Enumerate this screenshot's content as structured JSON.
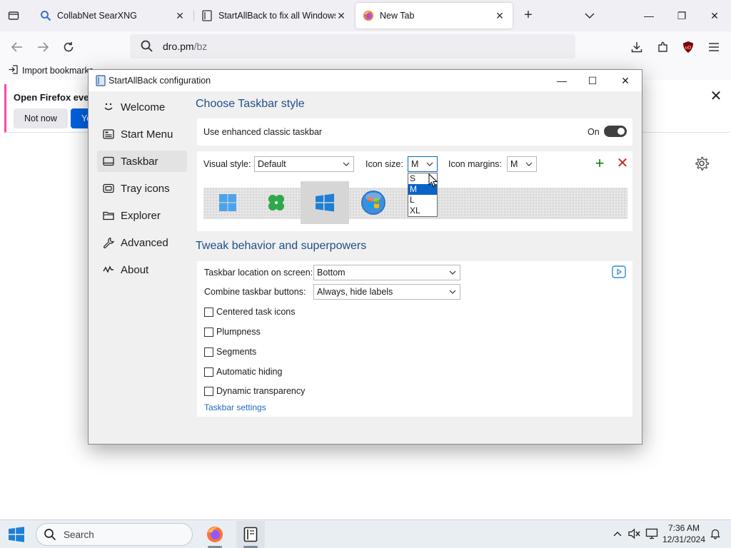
{
  "browser": {
    "tabs": [
      {
        "title": "CollabNet SearXNG",
        "active": false
      },
      {
        "title": "StartAllBack to fix all Windows",
        "active": false
      },
      {
        "title": "New Tab",
        "active": true
      }
    ],
    "new_tab_label": "+",
    "window_controls": {
      "minimize": "—",
      "restore": "❐",
      "close": "✕"
    },
    "url_host": "dro.pm",
    "url_path": "/bz",
    "bookmark_item": "Import bookmarks…",
    "notification": {
      "text": "Open Firefox every",
      "secondary_button": "Not now",
      "primary_button": "Yes"
    },
    "accent_color": "#0061e0"
  },
  "dialog": {
    "title": "StartAllBack configuration",
    "controls": {
      "minimize": "—",
      "maximize": "☐",
      "close": "✕"
    },
    "nav": [
      {
        "label": "Welcome",
        "icon": "smile-icon",
        "selected": false
      },
      {
        "label": "Start Menu",
        "icon": "start-menu-icon",
        "selected": false
      },
      {
        "label": "Taskbar",
        "icon": "taskbar-icon",
        "selected": true
      },
      {
        "label": "Tray icons",
        "icon": "tray-icon",
        "selected": false
      },
      {
        "label": "Explorer",
        "icon": "folder-icon",
        "selected": false
      },
      {
        "label": "Advanced",
        "icon": "wrench-icon",
        "selected": false
      },
      {
        "label": "About",
        "icon": "wave-icon",
        "selected": false
      }
    ],
    "taskbar_style": {
      "section_title": "Choose Taskbar style",
      "enhanced_label": "Use enhanced classic taskbar",
      "enhanced_state": "On",
      "visual_style_label": "Visual style:",
      "visual_style_value": "Default",
      "icon_size_label": "Icon size:",
      "icon_size_value": "M",
      "icon_size_options": [
        "S",
        "M",
        "L",
        "XL"
      ],
      "icon_size_selected": "M",
      "icon_margins_label": "Icon margins:",
      "icon_margins_value": "M",
      "add_button": "+",
      "remove_button": "✕",
      "styles": [
        "windows-11-logo",
        "clover-logo",
        "windows-10-logo",
        "windows-7-orb"
      ],
      "selected_style": "windows-10-logo"
    },
    "tweaks": {
      "section_title": "Tweak behavior and superpowers",
      "location_label": "Taskbar location on screen:",
      "location_value": "Bottom",
      "combine_label": "Combine taskbar buttons:",
      "combine_value": "Always, hide labels",
      "checkboxes": [
        {
          "label": "Centered task icons",
          "checked": false
        },
        {
          "label": "Plumpness",
          "checked": false
        },
        {
          "label": "Segments",
          "checked": false
        },
        {
          "label": "Automatic hiding",
          "checked": false
        },
        {
          "label": "Dynamic transparency",
          "checked": false
        }
      ],
      "settings_link": "Taskbar settings"
    },
    "title_color": "#1f4e8c",
    "selection_color": "#0a64c8"
  },
  "taskbar": {
    "search_placeholder": "Search",
    "time": "7:36 AM",
    "date": "12/31/2024",
    "pinned": [
      "firefox-icon",
      "startallback-icon"
    ]
  }
}
